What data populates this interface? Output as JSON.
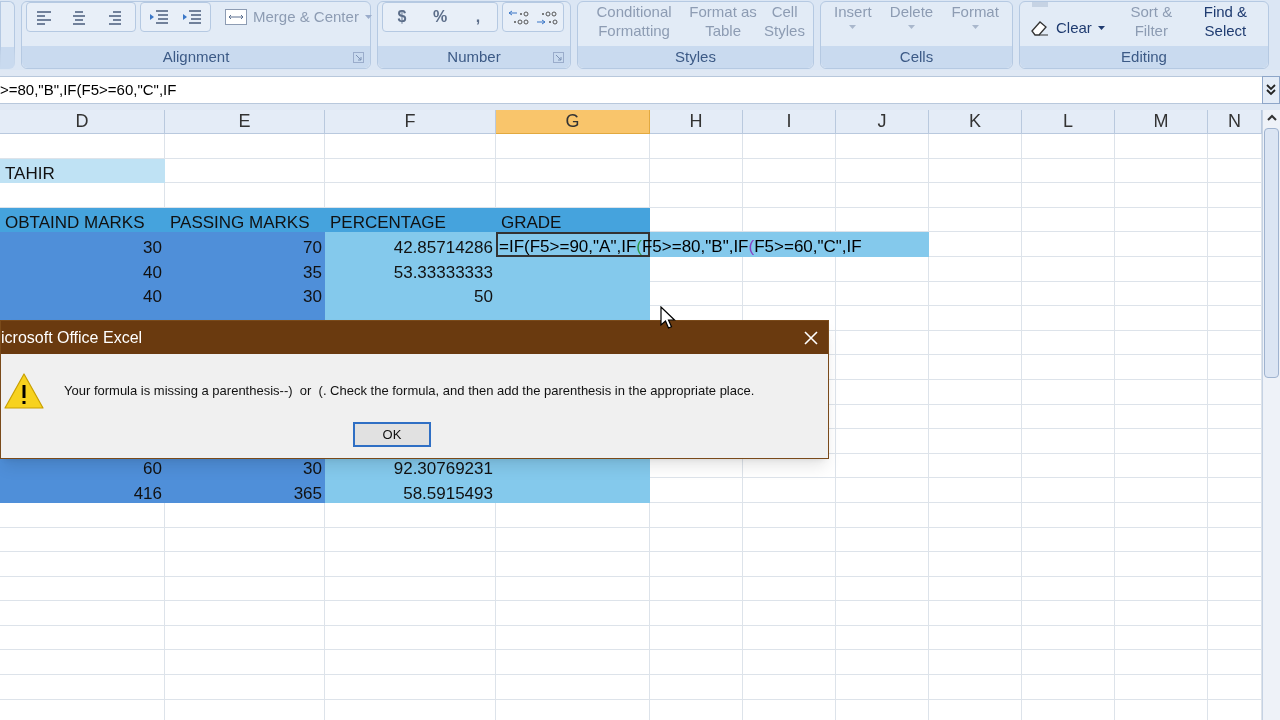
{
  "ribbon": {
    "groups": [
      {
        "kind": "alignment",
        "label": "Alignment",
        "merge": {
          "label": "Merge & Center",
          "disabled": true
        }
      },
      {
        "kind": "number",
        "label": "Number",
        "symbols": [
          "$",
          "%",
          ","
        ]
      },
      {
        "kind": "buttons",
        "label": "Styles",
        "buttons": [
          {
            "label": "Conditional Formatting",
            "disabled": true
          },
          {
            "label": "Format as Table",
            "disabled": true
          },
          {
            "label": "Cell Styles",
            "disabled": true
          }
        ]
      },
      {
        "kind": "buttons",
        "label": "Cells",
        "buttons": [
          {
            "label": "Insert",
            "disabled": true
          },
          {
            "label": "Delete",
            "disabled": true
          },
          {
            "label": "Format",
            "disabled": true
          }
        ]
      },
      {
        "kind": "editing",
        "label": "Editing",
        "clear": {
          "label": "Clear",
          "disabled": false
        },
        "buttons": [
          {
            "label": "Sort & Filter",
            "disabled": true
          },
          {
            "label": "Find & Select",
            "disabled": false
          }
        ]
      }
    ]
  },
  "formula_bar": {
    "value": ">=80,\"B\",IF(F5>=60,\"C\",IF"
  },
  "columns": [
    {
      "label": "D",
      "selected": false
    },
    {
      "label": "E",
      "selected": false
    },
    {
      "label": "F",
      "selected": false
    },
    {
      "label": "G",
      "selected": true
    },
    {
      "label": "H",
      "selected": false
    },
    {
      "label": "I",
      "selected": false
    },
    {
      "label": "J",
      "selected": false
    },
    {
      "label": "K",
      "selected": false
    },
    {
      "label": "L",
      "selected": false
    },
    {
      "label": "M",
      "selected": false
    },
    {
      "label": "N",
      "selected": false
    }
  ],
  "rows": [
    {
      "kind": "blank"
    },
    {
      "kind": "name",
      "value": "TAHIR"
    },
    {
      "kind": "blank"
    },
    {
      "kind": "header",
      "values": [
        "OBTAIND MARKS",
        "PASSING MARKS",
        "PERCENTAGE",
        "GRADE"
      ]
    },
    {
      "kind": "data",
      "values": [
        "30",
        "70",
        "42.85714286"
      ],
      "formula": [
        {
          "text": "=IF(F5>=90,\"A\",IF",
          "color": "#000000"
        },
        {
          "text": "(",
          "color": "#2e9a4a"
        },
        {
          "text": "F5>=80,\"B\",IF",
          "color": "#000000"
        },
        {
          "text": "(",
          "color": "#8a3fc4"
        },
        {
          "text": "F5>=60,\"C\",IF",
          "color": "#000000"
        }
      ]
    },
    {
      "kind": "data",
      "values": [
        "40",
        "35",
        "53.33333333"
      ]
    },
    {
      "kind": "data",
      "values": [
        "40",
        "30",
        "50"
      ]
    },
    {
      "kind": "data"
    },
    {
      "kind": "data"
    },
    {
      "kind": "data"
    },
    {
      "kind": "data"
    },
    {
      "kind": "data"
    },
    {
      "kind": "data"
    },
    {
      "kind": "data",
      "values": [
        "60",
        "30",
        "92.30769231"
      ]
    },
    {
      "kind": "data",
      "values": [
        "416",
        "365",
        "58.5915493"
      ]
    },
    {
      "kind": "blank"
    },
    {
      "kind": "blank"
    },
    {
      "kind": "blank"
    },
    {
      "kind": "blank"
    },
    {
      "kind": "blank"
    },
    {
      "kind": "blank"
    },
    {
      "kind": "blank"
    },
    {
      "kind": "blank"
    },
    {
      "kind": "blank"
    }
  ],
  "dialog": {
    "title": "icrosoft Office Excel",
    "message": "Your formula is missing a parenthesis--)  or  (. Check the formula, and then add the parenthesis in the appropriate place.",
    "button": "OK"
  }
}
